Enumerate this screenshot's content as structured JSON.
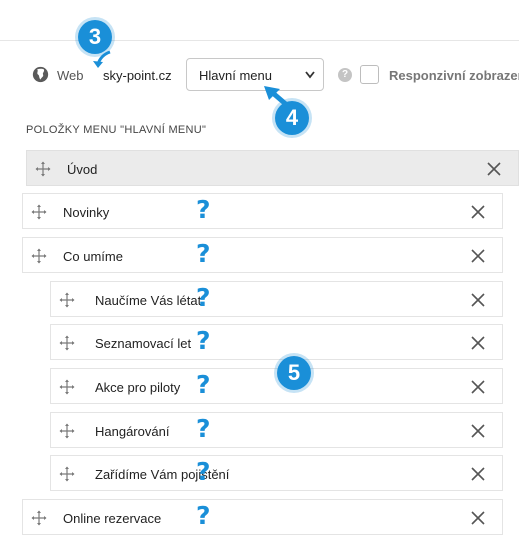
{
  "toolbar": {
    "web_label": "Web",
    "site_label": "sky-point.cz",
    "menu_select": "Hlavní menu",
    "help_glyph": "?",
    "responsive_label": "Responzivní zobrazení"
  },
  "section": {
    "title": "POLOŽKY MENU \"HLAVNÍ MENU\""
  },
  "menu_items": [
    {
      "label": "Úvod",
      "level": 0,
      "active": true,
      "help": false
    },
    {
      "label": "Novinky",
      "level": 0,
      "active": false,
      "help": true
    },
    {
      "label": "Co umíme",
      "level": 0,
      "active": false,
      "help": true
    },
    {
      "label": "Naučíme Vás létat",
      "level": 1,
      "active": false,
      "help": true
    },
    {
      "label": "Seznamovací let",
      "level": 1,
      "active": false,
      "help": true
    },
    {
      "label": "Akce pro piloty",
      "level": 1,
      "active": false,
      "help": true
    },
    {
      "label": "Hangárování",
      "level": 1,
      "active": false,
      "help": true
    },
    {
      "label": "Zařídíme Vám pojištění",
      "level": 1,
      "active": false,
      "help": true
    },
    {
      "label": "Online rezervace",
      "level": 0,
      "active": false,
      "help": true
    }
  ],
  "annotations": {
    "badge_3": "3",
    "badge_4": "4",
    "badge_5": "5",
    "qmark": "?"
  },
  "icons": [
    "globe-icon",
    "chevron-down-icon",
    "help-icon",
    "drag-handle-icon",
    "delete-x-icon",
    "arrow-icon"
  ],
  "colors": {
    "accent": "#1a8fd8",
    "active_row": "#ebebeb",
    "border": "#e4e4e4"
  }
}
